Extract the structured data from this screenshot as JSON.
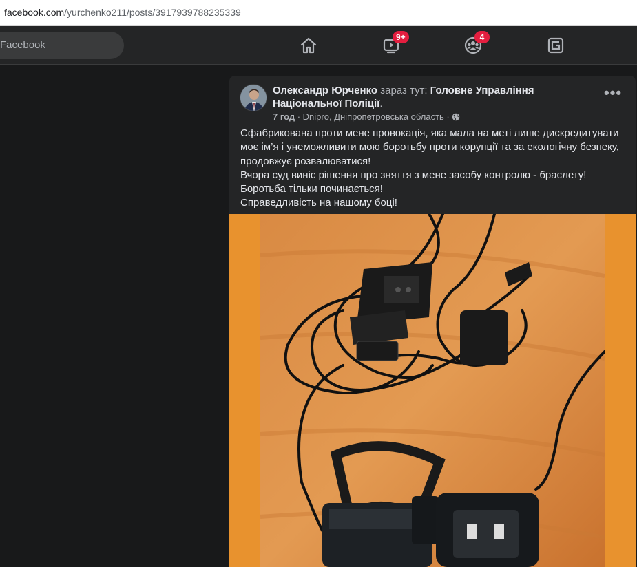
{
  "browser": {
    "url_host": "facebook.com",
    "url_path": "/yurchenko211/posts/3917939788235339"
  },
  "topnav": {
    "search_placeholder": "Facebook",
    "watch_badge": "9+",
    "groups_badge": "4",
    "icons": [
      "home-icon",
      "watch-icon",
      "groups-icon",
      "gaming-icon"
    ]
  },
  "post": {
    "author": "Олександр Юрченко",
    "location_prefix": " зараз тут: ",
    "location": "Головне Управління Національної Поліції",
    "location_suffix": ".",
    "time": "7 год",
    "meta_sep": " · ",
    "city": "Dnipro, Дніпропетровська область",
    "audience_icon": "globe-icon",
    "more_label": "•••",
    "lines": [
      "Сфабрикована проти мене провокація, яка мала на меті лише дискредитувати",
      "моє ім’я і унеможливити мою боротьбу проти корупції та за екологічну безпеку,",
      "продовжує розвалюватися!",
      "Вчора суд виніс рішення про зняття з мене засобу контролю - браслету!",
      "Боротьба тільки починається!",
      "Справедливість на нашому боці!"
    ]
  },
  "colors": {
    "page_bg": "#18191a",
    "card_bg": "#242526",
    "badge_red": "#e41e3f",
    "photo_border": "#e8922e"
  }
}
